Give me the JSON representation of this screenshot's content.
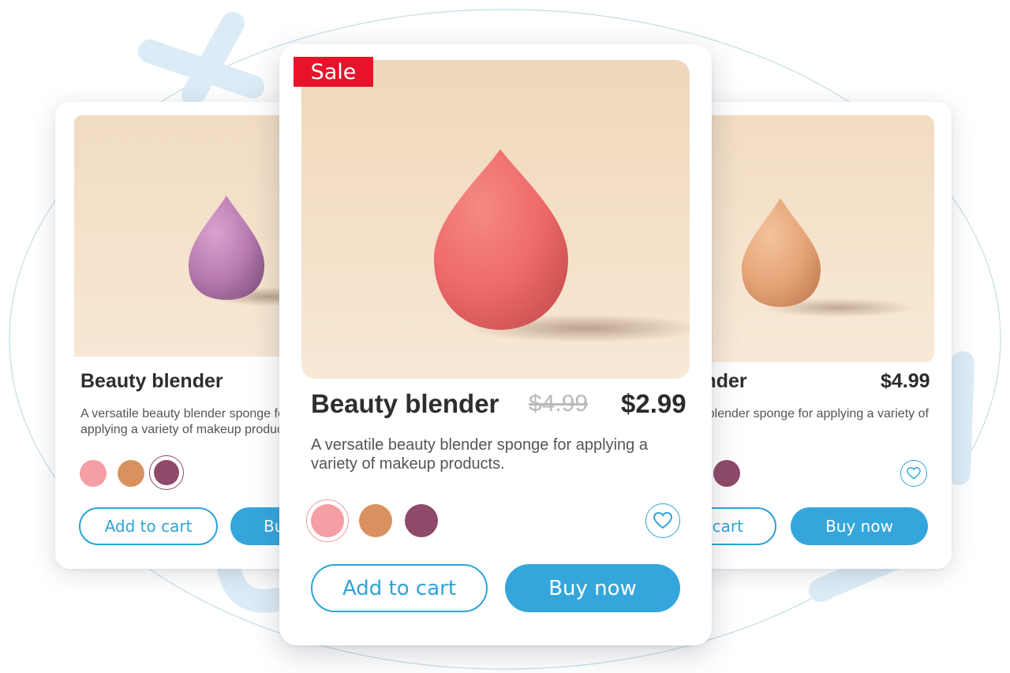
{
  "sale_badge": "Sale",
  "colors": {
    "accent": "#2ea4d8",
    "sale": "#e8132a",
    "swatch_pink": "#f59ea3",
    "swatch_tan": "#d9925f",
    "swatch_plum": "#8e4a68"
  },
  "cards": {
    "left": {
      "title": "Beauty blender",
      "description": "A versatile beauty blender sponge for applying a variety of makeup products.",
      "add_to_cart": "Add to cart",
      "buy_now": "Buy now",
      "selected_swatch": "plum"
    },
    "front": {
      "title": "Beauty blender",
      "old_price": "$4.99",
      "price": "$2.99",
      "description": "A versatile beauty blender sponge for applying a variety of makeup products.",
      "add_to_cart": "Add to cart",
      "buy_now": "Buy now",
      "selected_swatch": "pink"
    },
    "right": {
      "title": "Beauty blender",
      "price": "$4.99",
      "description": "A versatile beauty blender sponge for applying a variety of makeup products.",
      "add_to_cart": "Add to cart",
      "buy_now": "Buy now"
    }
  },
  "icons": {
    "wishlist": "heart-icon"
  }
}
